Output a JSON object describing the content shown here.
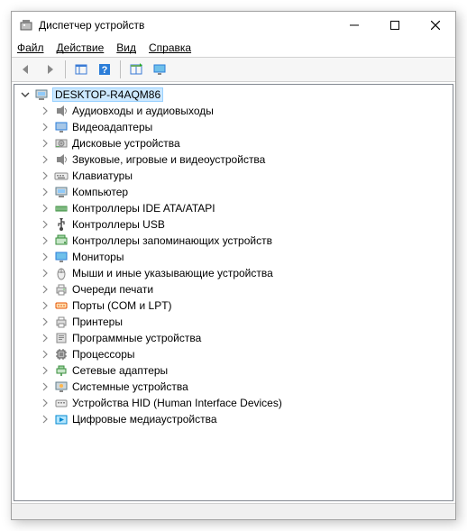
{
  "window": {
    "title": "Диспетчер устройств"
  },
  "menu": {
    "file": "Файл",
    "action": "Действие",
    "view": "Вид",
    "help": "Справка"
  },
  "tree": {
    "root": "DESKTOP-R4AQM86",
    "items": [
      {
        "icon": "audio",
        "label": "Аудиовходы и аудиовыходы"
      },
      {
        "icon": "display",
        "label": "Видеоадаптеры"
      },
      {
        "icon": "disk",
        "label": "Дисковые устройства"
      },
      {
        "icon": "audio",
        "label": "Звуковые, игровые и видеоустройства"
      },
      {
        "icon": "keyboard",
        "label": "Клавиатуры"
      },
      {
        "icon": "computer",
        "label": "Компьютер"
      },
      {
        "icon": "ide",
        "label": "Контроллеры IDE ATA/ATAPI"
      },
      {
        "icon": "usb",
        "label": "Контроллеры USB"
      },
      {
        "icon": "storage",
        "label": "Контроллеры запоминающих устройств"
      },
      {
        "icon": "monitor",
        "label": "Мониторы"
      },
      {
        "icon": "mouse",
        "label": "Мыши и иные указывающие устройства"
      },
      {
        "icon": "printq",
        "label": "Очереди печати"
      },
      {
        "icon": "port",
        "label": "Порты (COM и LPT)"
      },
      {
        "icon": "printer",
        "label": "Принтеры"
      },
      {
        "icon": "software",
        "label": "Программные устройства"
      },
      {
        "icon": "cpu",
        "label": "Процессоры"
      },
      {
        "icon": "network",
        "label": "Сетевые адаптеры"
      },
      {
        "icon": "system",
        "label": "Системные устройства"
      },
      {
        "icon": "hid",
        "label": "Устройства HID (Human Interface Devices)"
      },
      {
        "icon": "media",
        "label": "Цифровые медиаустройства"
      }
    ]
  }
}
